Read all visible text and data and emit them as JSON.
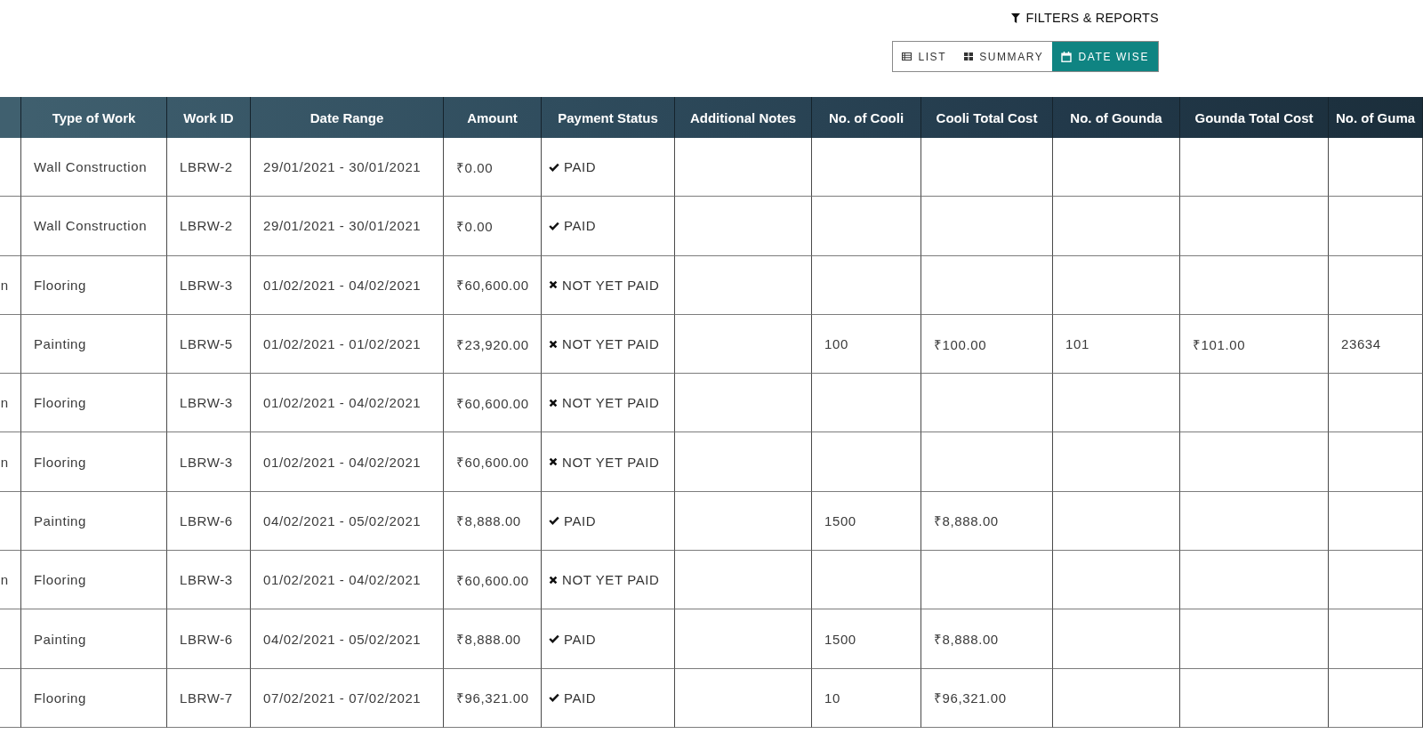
{
  "toolbar": {
    "filters_button": {
      "label": "FILTERS & REPORTS"
    },
    "view_tabs": [
      {
        "label": "LIST",
        "selected": false
      },
      {
        "label": "SUMMARY",
        "selected": false
      },
      {
        "label": "DATE WISE",
        "selected": true
      }
    ]
  },
  "table": {
    "columns": [
      "Type of Work",
      "Work ID",
      "Date Range",
      "Amount",
      "Payment Status",
      "Additional Notes",
      "No. of Cooli",
      "Cooli Total Cost",
      "No. of Gounda",
      "Gounda Total Cost",
      "No. of Guma"
    ],
    "rows": [
      {
        "type_of_work": "Wall Construction",
        "work_id": "LBRW-2",
        "date_range": "29/01/2021 - 30/01/2021",
        "amount": "₹0.00",
        "payment_status": {
          "label": "PAID",
          "paid": true
        }
      },
      {
        "type_of_work": "Wall Construction",
        "work_id": "LBRW-2",
        "date_range": "29/01/2021 - 30/01/2021",
        "amount": "₹0.00",
        "payment_status": {
          "label": "PAID",
          "paid": true
        }
      },
      {
        "column_1": "n",
        "type_of_work": "Flooring",
        "work_id": "LBRW-3",
        "date_range": "01/02/2021 - 04/02/2021",
        "amount": "₹60,600.00",
        "payment_status": {
          "label": "NOT YET PAID",
          "paid": false
        }
      },
      {
        "type_of_work": "Painting",
        "work_id": "LBRW-5",
        "date_range": "01/02/2021 - 01/02/2021",
        "amount": "₹23,920.00",
        "payment_status": {
          "label": "NOT YET PAID",
          "paid": false
        },
        "no_of_cooli": "100",
        "cooli_total_cost": "₹100.00",
        "no_of_gounda": "101",
        "gounda_total_cost": "₹101.00",
        "no_of_guma": "23634"
      },
      {
        "column_1": "n",
        "type_of_work": "Flooring",
        "work_id": "LBRW-3",
        "date_range": "01/02/2021 - 04/02/2021",
        "amount": "₹60,600.00",
        "payment_status": {
          "label": "NOT YET PAID",
          "paid": false
        }
      },
      {
        "column_1": "n",
        "type_of_work": "Flooring",
        "work_id": "LBRW-3",
        "date_range": "01/02/2021 - 04/02/2021",
        "amount": "₹60,600.00",
        "payment_status": {
          "label": "NOT YET PAID",
          "paid": false
        }
      },
      {
        "type_of_work": "Painting",
        "work_id": "LBRW-6",
        "date_range": "04/02/2021 - 05/02/2021",
        "amount": "₹8,888.00",
        "payment_status": {
          "label": "PAID",
          "paid": true
        },
        "no_of_cooli": "1500",
        "cooli_total_cost": "₹8,888.00"
      },
      {
        "column_1": "n",
        "type_of_work": "Flooring",
        "work_id": "LBRW-3",
        "date_range": "01/02/2021 - 04/02/2021",
        "amount": "₹60,600.00",
        "payment_status": {
          "label": "NOT YET PAID",
          "paid": false
        }
      },
      {
        "type_of_work": "Painting",
        "work_id": "LBRW-6",
        "date_range": "04/02/2021 - 05/02/2021",
        "amount": "₹8,888.00",
        "payment_status": {
          "label": "PAID",
          "paid": true
        },
        "no_of_cooli": "1500",
        "cooli_total_cost": "₹8,888.00"
      },
      {
        "type_of_work": "Flooring",
        "work_id": "LBRW-7",
        "date_range": "07/02/2021 - 07/02/2021",
        "amount": "₹96,321.00",
        "payment_status": {
          "label": "PAID",
          "paid": true
        },
        "no_of_cooli": "10",
        "cooli_total_cost": "₹96,321.00"
      }
    ]
  }
}
